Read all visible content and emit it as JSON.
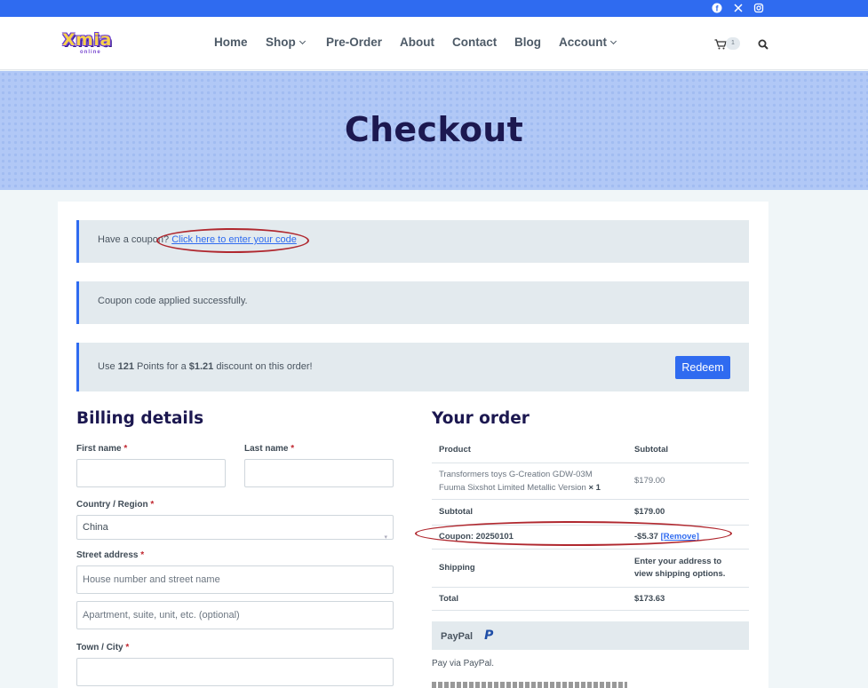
{
  "topbar": {
    "social": [
      "facebook-icon",
      "x-icon",
      "instagram-icon"
    ],
    "color": "#2f6bf0"
  },
  "brand": {
    "name": "Xmia",
    "sub": "online"
  },
  "nav": {
    "home": "Home",
    "shop": "Shop",
    "preorder": "Pre-Order",
    "about": "About",
    "contact": "Contact",
    "blog": "Blog",
    "account": "Account"
  },
  "cart": {
    "count": "1"
  },
  "hero": {
    "title": "Checkout"
  },
  "notices": {
    "coupon_prompt": "Have a coupon?",
    "coupon_link": "Click here to enter your code",
    "coupon_applied": "Coupon code applied successfully.",
    "points_pre": "Use",
    "points_value": "121",
    "points_mid": "Points for a",
    "points_amount": "$1.21",
    "points_post": "discount on this order!",
    "redeem": "Redeem"
  },
  "billing": {
    "title": "Billing details",
    "first_name": "First name",
    "last_name": "Last name",
    "country_label": "Country / Region",
    "country_value": "China",
    "street_label": "Street address",
    "street_placeholder": "House number and street name",
    "street2_placeholder": "Apartment, suite, unit, etc. (optional)",
    "town_label": "Town / City",
    "required": "*"
  },
  "order": {
    "title": "Your order",
    "col_product": "Product",
    "col_subtotal": "Subtotal",
    "item_line1": "Transformers toys G-Creation GDW-03M",
    "item_line2": "Fuuma Sixshot Limited Metallic Version",
    "item_qty": "× 1",
    "item_price": "$179.00",
    "subtotal_label": "Subtotal",
    "subtotal_value": "$179.00",
    "coupon_label": "Coupon: 20250101",
    "coupon_value": "-$5.37",
    "coupon_remove": "[Remove]",
    "shipping_label": "Shipping",
    "shipping_value": "Enter your address to view shipping options.",
    "total_label": "Total",
    "total_value": "$173.63"
  },
  "payment": {
    "method": "PayPal",
    "logo": "P",
    "description": "Pay via PayPal."
  }
}
